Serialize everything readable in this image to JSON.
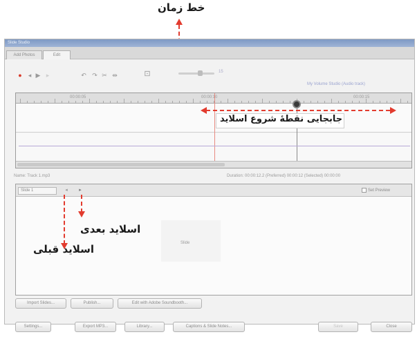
{
  "annotations": {
    "timeline_label": "خط زمان",
    "move_slide_start": "جابجایی نقطهٔ شروع اسلاید",
    "next_slide": "اسلاید بعدی",
    "previous_slide": "اسلاید قبلی"
  },
  "colors": {
    "annotation_arrow": "#e23b2e",
    "title_bar": "#8aa3cc"
  },
  "window": {
    "title": "Slide Studio",
    "tabs": [
      {
        "label": "Add Photos"
      },
      {
        "label": "Edit"
      }
    ]
  },
  "toolbar": {
    "icons": [
      "record-icon",
      "rewind-icon",
      "play-icon",
      "forward-icon",
      "undo-icon",
      "redo-icon",
      "split-icon",
      "lock-icon"
    ],
    "zoom_value": "15"
  },
  "project": {
    "label": "My Volume Studio (Audio track)"
  },
  "timeline": {
    "ruler_labels": [
      "00:00:05",
      "00:00:10",
      "00:00:15"
    ]
  },
  "status": {
    "name_label": "Name: Track 1.mp3",
    "duration_label": "Duration: 00:00:12.2 (Preferred) 00:00:12 (Selected) 00:00:00"
  },
  "slide_panel": {
    "slide_selector": "Slide 1",
    "preview_label": "Set Preview",
    "slide_placeholder": "Slide"
  },
  "buttons_row1": [
    {
      "label": "Import Slides..."
    },
    {
      "label": "Publish..."
    },
    {
      "label": "Edit with Adobe Soundbooth..."
    }
  ],
  "buttons_row2": [
    {
      "label": "Settings..."
    },
    {
      "label": "Export MP3..."
    },
    {
      "label": "Library..."
    },
    {
      "label": "Captions & Slide Notes..."
    }
  ],
  "buttons_right": [
    {
      "label": "Save"
    },
    {
      "label": "Close"
    }
  ]
}
